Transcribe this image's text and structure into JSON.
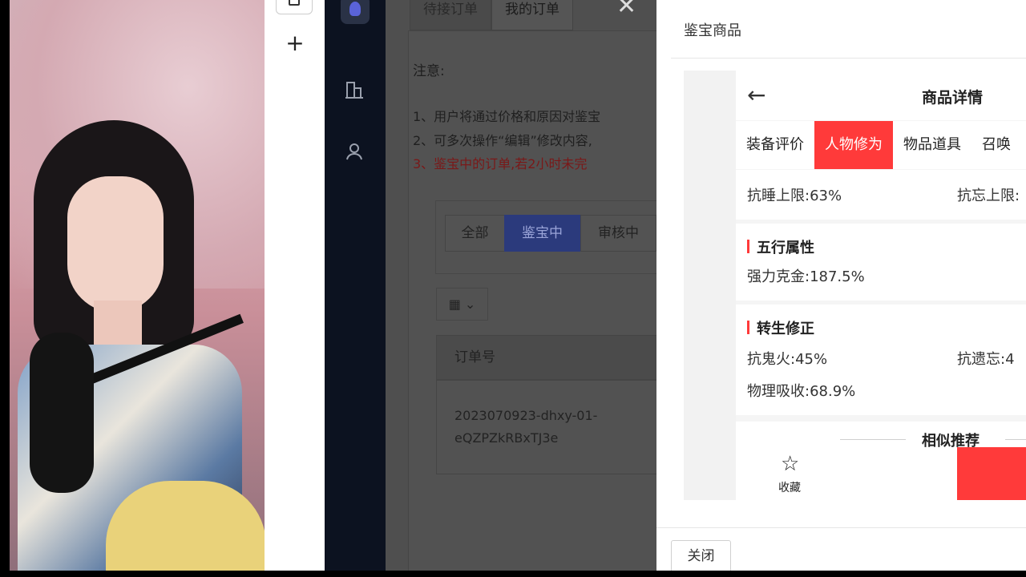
{
  "browser": {
    "new_tab_icon": "plus-icon",
    "tab_icon": "window-icon"
  },
  "sidebar": {
    "logo_icon": "app-logo-icon",
    "icons": [
      "building-icon",
      "user-icon"
    ]
  },
  "main": {
    "tabs": [
      {
        "label": "待接订单"
      },
      {
        "label": "我的订单"
      }
    ],
    "close_icon": "close-icon",
    "notice": {
      "title": "注意:",
      "lines": [
        "1、用户将通过价格和原因对鉴宝",
        "2、可多次操作“编辑”修改内容,",
        "3、鉴宝中的订单,若2小时未完"
      ]
    },
    "filters": [
      {
        "label": "全部"
      },
      {
        "label": "鉴宝中"
      },
      {
        "label": "审核中"
      }
    ],
    "columns_button_icon": "grid-icon",
    "table": {
      "header": "订单号",
      "order_id_line1": "2023070923-dhxy-01-",
      "order_id_line2": "eQZPZkRBxTJ3e"
    }
  },
  "drawer": {
    "title": "鉴宝商品",
    "phone": {
      "title": "商品详情",
      "back_icon": "arrow-left-icon",
      "tabs": [
        {
          "label": "装备评价"
        },
        {
          "label": "人物修为"
        },
        {
          "label": "物品道具"
        },
        {
          "label": "召唤"
        }
      ],
      "row1": {
        "left": "抗睡上限:63%",
        "right": "抗忘上限:"
      },
      "sections": [
        {
          "title": "五行属性",
          "items": [
            "强力克金:187.5%"
          ]
        },
        {
          "title": "转生修正",
          "items": [
            "抗鬼火:45%",
            "抗遗忘:4",
            "物理吸收:68.9%"
          ]
        }
      ],
      "similar": "相似推荐",
      "favorite": {
        "label": "收藏",
        "icon": "star-icon"
      }
    },
    "close_button": "关闭"
  },
  "colors": {
    "accent_red": "#ff3a3a",
    "active_filter": "#2b3a7c",
    "sidebar_bg": "#0c1220"
  }
}
